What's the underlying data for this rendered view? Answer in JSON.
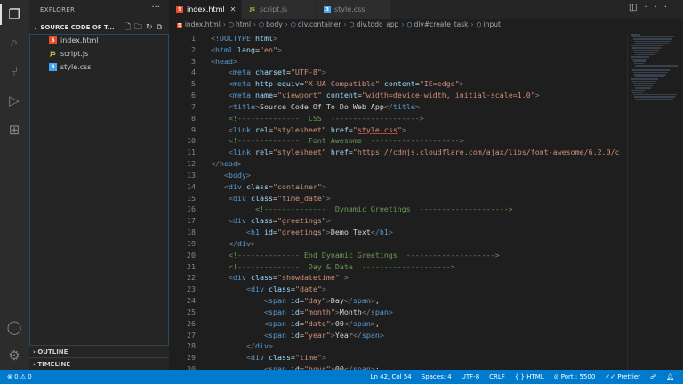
{
  "explorer": {
    "title": "EXPLORER",
    "folder": "SOURCE CODE OF T...",
    "files": [
      {
        "name": "index.html",
        "icon": "html",
        "color": "#e44d26",
        "glyph": "5"
      },
      {
        "name": "script.js",
        "icon": "js",
        "color": "#cbcb41",
        "glyph": "JS"
      },
      {
        "name": "style.css",
        "icon": "css",
        "color": "#42a5f5",
        "glyph": "3"
      }
    ],
    "outline": "OUTLINE",
    "timeline": "TIMELINE"
  },
  "tabs": [
    {
      "label": "index.html",
      "glyph": "5",
      "color": "#e44d26",
      "active": true
    },
    {
      "label": "script.js",
      "glyph": "JS",
      "color": "#cbcb41"
    },
    {
      "label": "style.css",
      "glyph": "3",
      "color": "#42a5f5"
    }
  ],
  "breadcrumb": [
    "index.html",
    "html",
    "body",
    "div.container",
    "div.todo_app",
    "div#create_task",
    "input"
  ],
  "code": [
    [
      0,
      [
        [
          "b",
          "<!"
        ],
        [
          "t",
          "DOCTYPE"
        ],
        [
          "a",
          " html"
        ],
        [
          "b",
          ">"
        ]
      ]
    ],
    [
      0,
      [
        [
          "b",
          "<"
        ],
        [
          "t",
          "html"
        ],
        [
          "a",
          " lang"
        ],
        [
          "p",
          "="
        ],
        [
          "s",
          "\"en\""
        ],
        [
          "b",
          ">"
        ]
      ]
    ],
    [
      0,
      [
        [
          "b",
          "<"
        ],
        [
          "t",
          "head"
        ],
        [
          "b",
          ">"
        ]
      ]
    ],
    [
      4,
      [
        [
          "b",
          "<"
        ],
        [
          "t",
          "meta"
        ],
        [
          "a",
          " charset"
        ],
        [
          "p",
          "="
        ],
        [
          "s",
          "\"UTF-8\""
        ],
        [
          "b",
          ">"
        ]
      ]
    ],
    [
      4,
      [
        [
          "b",
          "<"
        ],
        [
          "t",
          "meta"
        ],
        [
          "a",
          " http-equiv"
        ],
        [
          "p",
          "="
        ],
        [
          "s",
          "\"X-UA-Compatible\""
        ],
        [
          "a",
          " content"
        ],
        [
          "p",
          "="
        ],
        [
          "s",
          "\"IE=edge\""
        ],
        [
          "b",
          ">"
        ]
      ]
    ],
    [
      4,
      [
        [
          "b",
          "<"
        ],
        [
          "t",
          "meta"
        ],
        [
          "a",
          " name"
        ],
        [
          "p",
          "="
        ],
        [
          "s",
          "\"viewport\""
        ],
        [
          "a",
          " content"
        ],
        [
          "p",
          "="
        ],
        [
          "s",
          "\"width=device-width, initial-scale=1.0\""
        ],
        [
          "b",
          ">"
        ]
      ]
    ],
    [
      4,
      [
        [
          "b",
          "<"
        ],
        [
          "t",
          "title"
        ],
        [
          "b",
          ">"
        ],
        [
          "p",
          "Source Code Of To Do Web App"
        ],
        [
          "b",
          "</"
        ],
        [
          "t",
          "title"
        ],
        [
          "b",
          ">"
        ]
      ]
    ],
    [
      4,
      [
        [
          "c",
          "<!--------------  CSS  -------------------->"
        ]
      ]
    ],
    [
      4,
      [
        [
          "b",
          "<"
        ],
        [
          "t",
          "link"
        ],
        [
          "a",
          " rel"
        ],
        [
          "p",
          "="
        ],
        [
          "s",
          "\"stylesheet\""
        ],
        [
          "a",
          " href"
        ],
        [
          "p",
          "="
        ],
        [
          "s",
          "\""
        ],
        [
          "u",
          "style.css"
        ],
        [
          "s",
          "\""
        ],
        [
          "b",
          ">"
        ]
      ]
    ],
    [
      4,
      [
        [
          "c",
          "<!--------------  Font Awesome  -------------------->"
        ]
      ]
    ],
    [
      4,
      [
        [
          "b",
          "<"
        ],
        [
          "t",
          "link"
        ],
        [
          "a",
          " rel"
        ],
        [
          "p",
          "="
        ],
        [
          "s",
          "\"stylesheet\""
        ],
        [
          "a",
          " href"
        ],
        [
          "p",
          "="
        ],
        [
          "s",
          "\""
        ],
        [
          "u",
          "https://cdnjs.cloudflare.com/ajax/libs/font-awesome/6.2.0/c"
        ]
      ]
    ],
    [
      0,
      [
        [
          "b",
          "</"
        ],
        [
          "t",
          "head"
        ],
        [
          "b",
          ">"
        ]
      ]
    ],
    [
      3,
      [
        [
          "b",
          "<"
        ],
        [
          "t",
          "body"
        ],
        [
          "b",
          ">"
        ]
      ]
    ],
    [
      3,
      [
        [
          "b",
          "<"
        ],
        [
          "t",
          "div"
        ],
        [
          "a",
          " class"
        ],
        [
          "p",
          "="
        ],
        [
          "s",
          "\"container\""
        ],
        [
          "b",
          ">"
        ]
      ]
    ],
    [
      4,
      [
        [
          "b",
          "<"
        ],
        [
          "t",
          "div"
        ],
        [
          "a",
          " class"
        ],
        [
          "p",
          "="
        ],
        [
          "s",
          "\"time_date\""
        ],
        [
          "b",
          ">"
        ]
      ]
    ],
    [
      10,
      [
        [
          "c",
          "<!--------------  Dynamic Greetings  -------------------->"
        ]
      ]
    ],
    [
      4,
      [
        [
          "b",
          "<"
        ],
        [
          "t",
          "div"
        ],
        [
          "a",
          " class"
        ],
        [
          "p",
          "="
        ],
        [
          "s",
          "\"greetings\""
        ],
        [
          "b",
          ">"
        ]
      ]
    ],
    [
      8,
      [
        [
          "b",
          "<"
        ],
        [
          "t",
          "h1"
        ],
        [
          "a",
          " id"
        ],
        [
          "p",
          "="
        ],
        [
          "s",
          "\"greetings\""
        ],
        [
          "b",
          ">"
        ],
        [
          "p",
          "Demo Text"
        ],
        [
          "b",
          "</"
        ],
        [
          "t",
          "h1"
        ],
        [
          "b",
          ">"
        ]
      ]
    ],
    [
      4,
      [
        [
          "b",
          "</"
        ],
        [
          "t",
          "div"
        ],
        [
          "b",
          ">"
        ]
      ]
    ],
    [
      4,
      [
        [
          "c",
          "<!-------------- End Dynamic Greetings  -------------------->"
        ]
      ]
    ],
    [
      4,
      [
        [
          "c",
          "<!--------------  Day & Date  -------------------->"
        ]
      ]
    ],
    [
      4,
      [
        [
          "b",
          "<"
        ],
        [
          "t",
          "div"
        ],
        [
          "a",
          " class"
        ],
        [
          "p",
          "="
        ],
        [
          "s",
          "\"showdatetime\""
        ],
        [
          "b",
          " >"
        ]
      ]
    ],
    [
      8,
      [
        [
          "b",
          "<"
        ],
        [
          "t",
          "div"
        ],
        [
          "a",
          " class"
        ],
        [
          "p",
          "="
        ],
        [
          "s",
          "\"date\""
        ],
        [
          "b",
          ">"
        ]
      ]
    ],
    [
      12,
      [
        [
          "b",
          "<"
        ],
        [
          "t",
          "span"
        ],
        [
          "a",
          " id"
        ],
        [
          "p",
          "="
        ],
        [
          "s",
          "\"day\""
        ],
        [
          "b",
          ">"
        ],
        [
          "p",
          "Day"
        ],
        [
          "b",
          "</"
        ],
        [
          "t",
          "span"
        ],
        [
          "b",
          ">"
        ],
        [
          "p",
          ","
        ]
      ]
    ],
    [
      12,
      [
        [
          "b",
          "<"
        ],
        [
          "t",
          "span"
        ],
        [
          "a",
          " id"
        ],
        [
          "p",
          "="
        ],
        [
          "s",
          "\"month\""
        ],
        [
          "b",
          ">"
        ],
        [
          "p",
          "Month"
        ],
        [
          "b",
          "</"
        ],
        [
          "t",
          "span"
        ],
        [
          "b",
          ">"
        ]
      ]
    ],
    [
      12,
      [
        [
          "b",
          "<"
        ],
        [
          "t",
          "span"
        ],
        [
          "a",
          " id"
        ],
        [
          "p",
          "="
        ],
        [
          "s",
          "\"date\""
        ],
        [
          "b",
          ">"
        ],
        [
          "p",
          "00"
        ],
        [
          "b",
          "</"
        ],
        [
          "t",
          "span"
        ],
        [
          "b",
          ">"
        ],
        [
          "p",
          ","
        ]
      ]
    ],
    [
      12,
      [
        [
          "b",
          "<"
        ],
        [
          "t",
          "span"
        ],
        [
          "a",
          " id"
        ],
        [
          "p",
          "="
        ],
        [
          "s",
          "\"year\""
        ],
        [
          "b",
          ">"
        ],
        [
          "p",
          "Year"
        ],
        [
          "b",
          "</"
        ],
        [
          "t",
          "span"
        ],
        [
          "b",
          ">"
        ]
      ]
    ],
    [
      8,
      [
        [
          "b",
          "</"
        ],
        [
          "t",
          "div"
        ],
        [
          "b",
          ">"
        ]
      ]
    ],
    [
      8,
      [
        [
          "b",
          "<"
        ],
        [
          "t",
          "div"
        ],
        [
          "a",
          " class"
        ],
        [
          "p",
          "="
        ],
        [
          "s",
          "\"time\""
        ],
        [
          "b",
          ">"
        ]
      ]
    ],
    [
      12,
      [
        [
          "b",
          "<"
        ],
        [
          "t",
          "span"
        ],
        [
          "a",
          " id"
        ],
        [
          "p",
          "="
        ],
        [
          "s",
          "\"hour\""
        ],
        [
          "b",
          ">"
        ],
        [
          "p",
          "00"
        ],
        [
          "b",
          "</"
        ],
        [
          "t",
          "span"
        ],
        [
          "b",
          ">"
        ],
        [
          "p",
          ":"
        ]
      ]
    ]
  ],
  "status": {
    "errors": "0",
    "warnings": "0",
    "position": "Ln 42, Col 54",
    "spaces": "Spaces: 4",
    "encoding": "UTF-8",
    "eol": "CRLF",
    "language": "HTML",
    "port": "Port : 5500",
    "prettier": "Prettier"
  }
}
